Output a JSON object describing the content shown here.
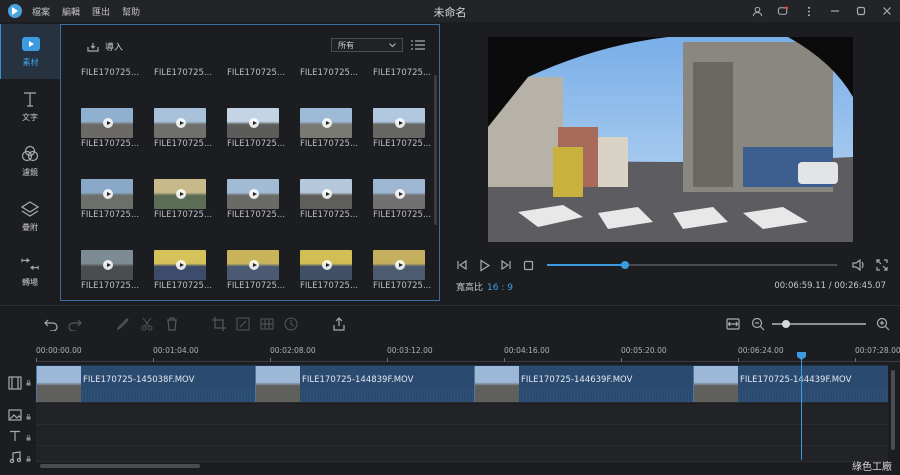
{
  "window": {
    "title": "未命名",
    "menu": [
      "檔案",
      "編輯",
      "匯出",
      "幫助"
    ],
    "controls": [
      "user-icon",
      "feedback-icon",
      "more-icon",
      "minimize-icon",
      "maximize-icon",
      "close-icon"
    ]
  },
  "sidebar": {
    "items": [
      {
        "label": "素材",
        "icon": "media-icon",
        "active": true
      },
      {
        "label": "文字",
        "icon": "text-icon",
        "active": false
      },
      {
        "label": "濾鏡",
        "icon": "filter-icon",
        "active": false
      },
      {
        "label": "疊附",
        "icon": "overlay-icon",
        "active": false
      },
      {
        "label": "轉場",
        "icon": "transition-icon",
        "active": false
      }
    ]
  },
  "media": {
    "import_label": "導入",
    "filter_value": "所有",
    "files": [
      "FILE170725...",
      "FILE170725...",
      "FILE170725...",
      "FILE170725...",
      "FILE170725...",
      "FILE170725...",
      "FILE170725...",
      "FILE170725...",
      "FILE170725...",
      "FILE170725...",
      "FILE170725...",
      "FILE170725...",
      "FILE170725...",
      "FILE170725...",
      "FILE170725...",
      "FILE170725...",
      "FILE170725...",
      "FILE170725...",
      "FILE170725...",
      "FILE170725..."
    ]
  },
  "player": {
    "aspect_label": "寬高比",
    "aspect_value": "16 : 9",
    "timecode": "00:06:59.11 / 00:26:45.07",
    "progress": 0.27
  },
  "timeline": {
    "ruler": [
      "00:00:00.00",
      "00:01:04.00",
      "00:02:08.00",
      "00:03:12.00",
      "00:04:16.00",
      "00:05:20.00",
      "00:06:24.00",
      "00:07:28.00"
    ],
    "zoom_level": 0.15,
    "clips": [
      {
        "name": "FILE170725-145038F.MOV"
      },
      {
        "name": "FILE170725-144839F.MOV"
      },
      {
        "name": "FILE170725-144639F.MOV"
      },
      {
        "name": "FILE170725-144439F.MOV"
      }
    ]
  },
  "watermark": "綠色工廠",
  "colors": {
    "accent": "#3b9ae0",
    "panel_border": "#3b6e9e",
    "clip": "#2b4a70"
  }
}
